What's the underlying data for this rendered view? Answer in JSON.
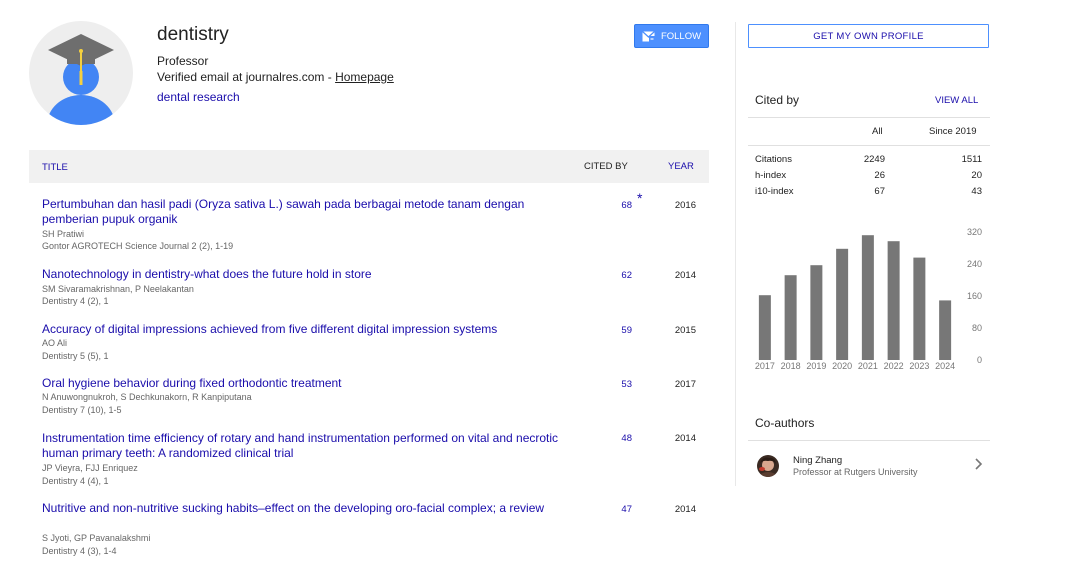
{
  "profile": {
    "name": "dentistry",
    "role": "Professor",
    "verified_text": "Verified email at journalres.com - ",
    "homepage_label": "Homepage",
    "interest": "dental research"
  },
  "buttons": {
    "follow": "FOLLOW",
    "get_profile": "GET MY OWN PROFILE"
  },
  "table": {
    "col_title": "TITLE",
    "col_cited": "CITED BY",
    "col_year": "YEAR",
    "rows": [
      {
        "title": "Pertumbuhan dan hasil padi (Oryza sativa L.) sawah pada berbagai metode tanam dengan pemberian pupuk organik",
        "authors": "SH Pratiwi",
        "venue": "Gontor AGROTECH Science Journal 2 (2), 1-19",
        "cited": "68",
        "year": "2016",
        "star": "*"
      },
      {
        "title": "Nanotechnology in dentistry-what does the future hold in store",
        "authors": "SM Sivaramakrishnan, P Neelakantan",
        "venue": "Dentistry 4 (2), 1",
        "cited": "62",
        "year": "2014"
      },
      {
        "title": "Accuracy of digital impressions achieved from five different digital impression systems",
        "authors": "AO Ali",
        "venue": "Dentistry 5 (5), 1",
        "cited": "59",
        "year": "2015"
      },
      {
        "title": "Oral hygiene behavior during fixed orthodontic treatment",
        "authors": "N Anuwongnukroh, S Dechkunakorn, R Kanpiputana",
        "venue": "Dentistry 7 (10), 1-5",
        "cited": "53",
        "year": "2017"
      },
      {
        "title": "Instrumentation time efficiency of rotary and hand instrumentation performed on vital and necrotic human primary teeth: A randomized clinical trial",
        "authors": "JP Vieyra, FJJ Enriquez",
        "venue": "Dentistry 4 (4), 1",
        "cited": "48",
        "year": "2014"
      },
      {
        "title": "Nutritive and non-nutritive sucking habits–effect on the developing oro-facial complex; a review",
        "authors": "S Jyoti, GP Pavanalakshmi",
        "venue": "Dentistry 4 (3), 1-4",
        "cited": "47",
        "year": "2014"
      }
    ]
  },
  "cited_by": {
    "label": "Cited by",
    "view_all": "VIEW ALL",
    "col_all": "All",
    "col_since": "Since 2019",
    "stats": [
      {
        "label": "Citations",
        "all": "2249",
        "since": "1511"
      },
      {
        "label": "h-index",
        "all": "26",
        "since": "20"
      },
      {
        "label": "i10-index",
        "all": "67",
        "since": "43"
      }
    ]
  },
  "chart_data": {
    "type": "bar",
    "categories": [
      "2017",
      "2018",
      "2019",
      "2020",
      "2021",
      "2022",
      "2023",
      "2024"
    ],
    "values": [
      162,
      212,
      237,
      278,
      312,
      297,
      256,
      149
    ],
    "y_ticks": [
      "320",
      "240",
      "160",
      "80",
      "0"
    ],
    "ylim": [
      0,
      320
    ],
    "bar_color": "#777777"
  },
  "coauthors": {
    "label": "Co-authors",
    "items": [
      {
        "name": "Ning Zhang",
        "affiliation": "Professor at Rutgers University"
      }
    ]
  },
  "colors": {
    "link": "#1a0dab",
    "button_blue": "#4d90fe",
    "avatar_blue": "#4285f4",
    "cap_gray": "#6e6e6e",
    "tassel": "#f4d03f"
  },
  "icons": {
    "follow": "mail-icon",
    "coauthor_nav": "chevron-right-icon",
    "avatar": "graduate-avatar-icon"
  }
}
